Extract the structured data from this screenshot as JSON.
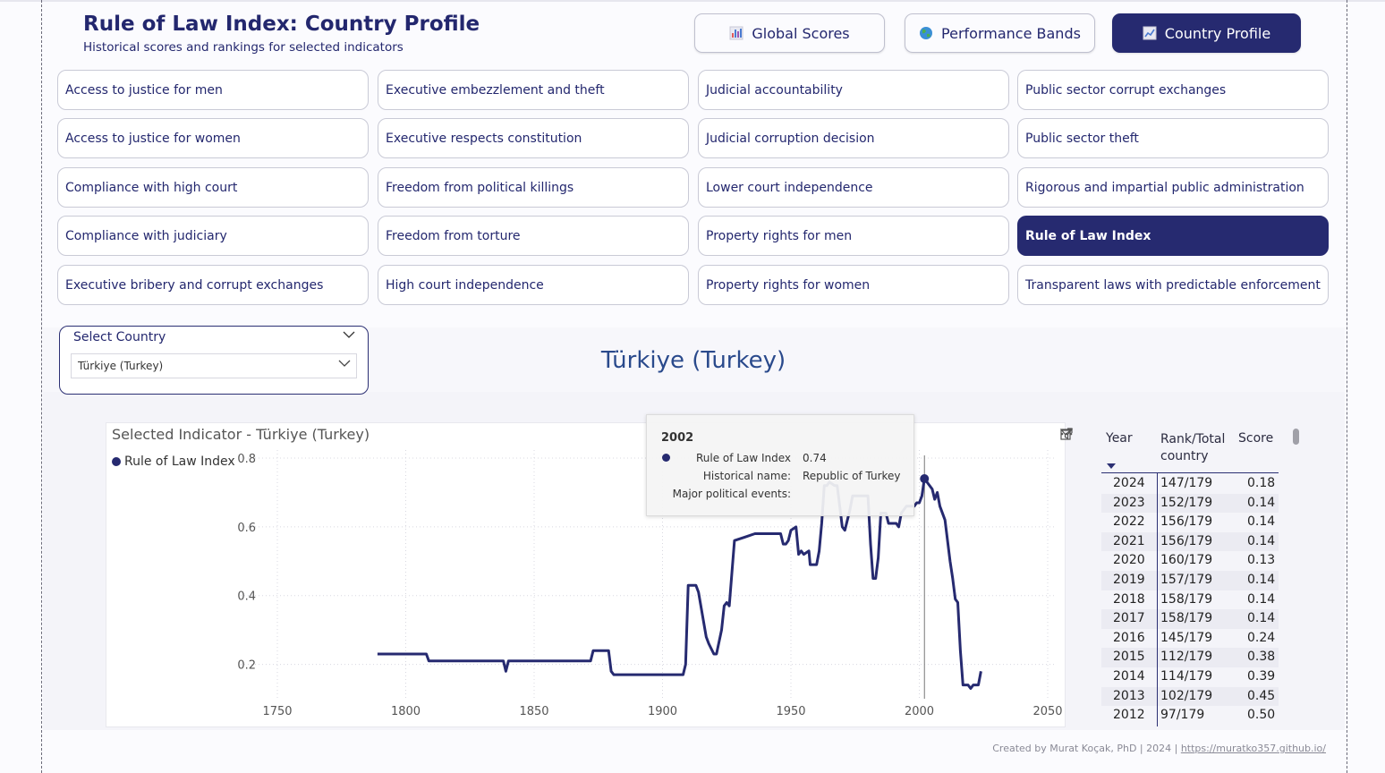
{
  "header": {
    "title": "Rule of Law Index: Country Profile",
    "subtitle": "Historical scores and rankings for selected indicators"
  },
  "nav": {
    "buttons": [
      {
        "label": "Global Scores",
        "icon": "bar-chart-icon"
      },
      {
        "label": "Performance Bands",
        "icon": "globe-icon"
      },
      {
        "label": "Country Profile",
        "icon": "line-chart-icon",
        "active": true
      }
    ]
  },
  "indicators": [
    [
      "Access to justice for men",
      "Executive embezzlement and theft",
      "Judicial accountability",
      "Public sector corrupt exchanges"
    ],
    [
      "Access to justice for women",
      "Executive respects constitution",
      "Judicial corruption decision",
      "Public sector theft"
    ],
    [
      "Compliance with high court",
      "Freedom from political killings",
      "Lower court independence",
      "Rigorous and impartial public administration"
    ],
    [
      "Compliance with judiciary",
      "Freedom from torture",
      "Property rights for men",
      "Rule of Law Index"
    ],
    [
      "Executive bribery and corrupt exchanges",
      "High court independence",
      "Property rights for women",
      "Transparent laws with predictable enforcement"
    ]
  ],
  "selected_indicator": "Rule of Law Index",
  "slicer": {
    "label": "Select Country",
    "value": "Türkiye (Turkey)"
  },
  "country_title": "Türkiye (Turkey)",
  "chart": {
    "title": "Selected Indicator - Türkiye (Turkey)",
    "legend": "Rule of Law Index",
    "icons": [
      "filter-icon",
      "focus-mode-icon",
      "more-options-icon"
    ]
  },
  "chart_data": {
    "type": "line",
    "series": [
      {
        "name": "Rule of Law Index"
      }
    ],
    "xlim": [
      1750,
      2050
    ],
    "ylim": [
      0.1,
      0.8
    ],
    "xticks": [
      1750,
      1800,
      1850,
      1900,
      1950,
      2000,
      2050
    ],
    "yticks": [
      0.2,
      0.4,
      0.6,
      0.8
    ],
    "tick_labels_x": [
      "1750",
      "1800",
      "1850",
      "1900",
      "1950",
      "2000",
      "2050"
    ],
    "tick_labels_y": [
      "0.2",
      "0.4",
      "0.6",
      "0.8"
    ],
    "grid": true,
    "legend_position": "top-left",
    "x": [
      1789,
      1808,
      1809,
      1838,
      1839,
      1840,
      1861,
      1862,
      1872,
      1873,
      1879,
      1880,
      1881,
      1906,
      1908,
      1909,
      1910,
      1913,
      1914,
      1917,
      1918,
      1920,
      1921,
      1923,
      1924,
      1925,
      1926,
      1928,
      1932,
      1936,
      1946,
      1947,
      1948,
      1949,
      1950,
      1952,
      1953,
      1954,
      1955,
      1957,
      1957.5,
      1960,
      1961,
      1962,
      1963,
      1964,
      1965,
      1967,
      1968,
      1970,
      1971,
      1973,
      1974,
      1977,
      1980,
      1981,
      1982,
      1983,
      1984,
      1985,
      1987,
      1988,
      1991,
      1992,
      1993,
      1994,
      1995,
      1996,
      1998,
      1999,
      2000,
      2001,
      2002,
      2003,
      2005,
      2006,
      2007,
      2008,
      2010,
      2012,
      2013,
      2014,
      2015,
      2016,
      2017,
      2018,
      2019,
      2020,
      2021,
      2022,
      2023,
      2024
    ],
    "y": [
      0.23,
      0.23,
      0.21,
      0.21,
      0.18,
      0.21,
      0.21,
      0.21,
      0.21,
      0.24,
      0.24,
      0.18,
      0.17,
      0.17,
      0.17,
      0.2,
      0.43,
      0.43,
      0.41,
      0.28,
      0.26,
      0.23,
      0.23,
      0.3,
      0.37,
      0.38,
      0.37,
      0.56,
      0.57,
      0.58,
      0.58,
      0.55,
      0.55,
      0.56,
      0.59,
      0.6,
      0.52,
      0.53,
      0.52,
      0.53,
      0.49,
      0.49,
      0.53,
      0.61,
      0.72,
      0.72,
      0.73,
      0.72,
      0.72,
      0.6,
      0.59,
      0.65,
      0.69,
      0.69,
      0.69,
      0.55,
      0.45,
      0.45,
      0.51,
      0.64,
      0.64,
      0.61,
      0.61,
      0.6,
      0.64,
      0.65,
      0.66,
      0.66,
      0.66,
      0.67,
      0.67,
      0.69,
      0.74,
      0.73,
      0.71,
      0.68,
      0.7,
      0.66,
      0.62,
      0.5,
      0.45,
      0.39,
      0.38,
      0.24,
      0.14,
      0.14,
      0.14,
      0.13,
      0.14,
      0.14,
      0.14,
      0.18
    ]
  },
  "tooltip": {
    "year": "2002",
    "rows": [
      {
        "label": "Rule of Law Index",
        "value": "0.74"
      },
      {
        "label": "Historical name:",
        "value": "Republic of Turkey"
      },
      {
        "label": "Major political events:",
        "value": ""
      }
    ]
  },
  "table": {
    "headers": [
      "Year",
      "Rank/Total country",
      "Score"
    ],
    "rows": [
      [
        "2024",
        "147/179",
        "0.18"
      ],
      [
        "2023",
        "152/179",
        "0.14"
      ],
      [
        "2022",
        "156/179",
        "0.14"
      ],
      [
        "2021",
        "156/179",
        "0.14"
      ],
      [
        "2020",
        "160/179",
        "0.13"
      ],
      [
        "2019",
        "157/179",
        "0.14"
      ],
      [
        "2018",
        "158/179",
        "0.14"
      ],
      [
        "2017",
        "158/179",
        "0.14"
      ],
      [
        "2016",
        "145/179",
        "0.24"
      ],
      [
        "2015",
        "112/179",
        "0.38"
      ],
      [
        "2014",
        "114/179",
        "0.39"
      ],
      [
        "2013",
        "102/179",
        "0.45"
      ],
      [
        "2012",
        "97/179",
        "0.50"
      ]
    ]
  },
  "footer": {
    "text": "Created by Murat Koçak, PhD | 2024 | ",
    "link": "https://muratko357.github.io/"
  },
  "colors": {
    "accent": "#262a70",
    "line": "#262a70"
  }
}
